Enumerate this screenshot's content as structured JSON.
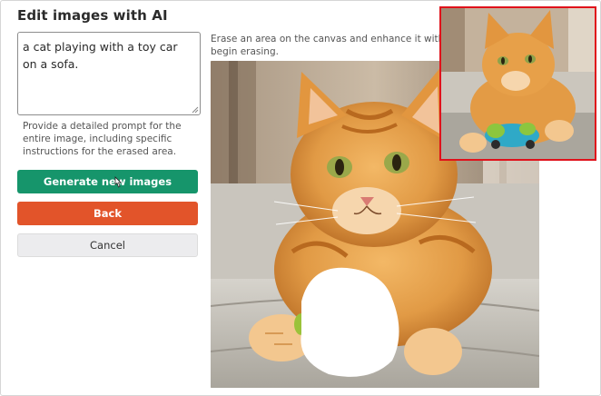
{
  "editor": {
    "title": "Edit images with AI",
    "prompt_text": "a cat playing with a toy car on a sofa.",
    "help_text": "Provide a detailed prompt for the entire image, including specific instructions for the erased area.",
    "instructions_line1": "Erase an area on the canvas and enhance it with a prompt.",
    "instructions_line2": "begin erasing."
  },
  "buttons": {
    "generate_label": "Generate new images",
    "back_label": "Back",
    "cancel_label": "Cancel"
  },
  "colors": {
    "generate": "#16956b",
    "back": "#e2542a",
    "cancel": "#ececee",
    "thumbnail_border": "#e0121b"
  },
  "icons": [
    "mouse-pointer-icon",
    "textarea-resize-icon"
  ]
}
